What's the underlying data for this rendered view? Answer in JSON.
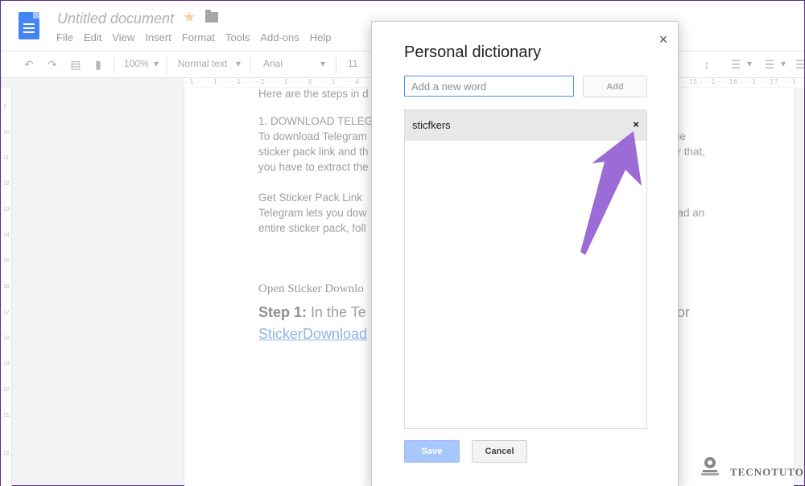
{
  "app": {
    "doc_title": "Untitled document",
    "menu": [
      "File",
      "Edit",
      "View",
      "Insert",
      "Format",
      "Tools",
      "Add-ons",
      "Help"
    ]
  },
  "toolbar": {
    "zoom": "100%",
    "style": "Normal text",
    "font": "Arial",
    "font_size": "11"
  },
  "ruler": {
    "text": "· 1 · · · 1 · · · 1 · · · 2 · · · 1 · · · 3 · · · 1 · · · 4",
    "right_text": "· 15 · · 1 · · 16 · · 1 · · 17 · · 1 · · 18 · ·",
    "vertical": [
      "1",
      "10",
      "11",
      "12",
      "13",
      "14",
      "15",
      "16",
      "17",
      "18",
      "19",
      "20",
      "21",
      "22"
    ]
  },
  "document": {
    "line1": "Here are the steps in d",
    "line2": "1. DOWNLOAD TELEG",
    "line3": "To download Telegram",
    "line3_right": "he",
    "line4": "sticker pack link and th",
    "line4_right": "er that,",
    "line5": "you have to extract the",
    "line6": "Get Sticker Pack Link",
    "line7": "Telegram lets you dow",
    "line7_right": "oad an",
    "line8": "entire sticker pack, foll",
    "line9": "Open Sticker Downlo",
    "step_label": "Step 1:",
    "step_text": " In the Te",
    "step_right": "or",
    "link_text": "StickerDownload"
  },
  "dialog": {
    "title": "Personal dictionary",
    "input_placeholder": "Add a new word",
    "add_label": "Add",
    "words": [
      "sticfkers"
    ],
    "remove_glyph": "×",
    "close_glyph": "×",
    "save_label": "Save",
    "cancel_label": "Cancel"
  },
  "watermark": {
    "text": "TECNOTUTO"
  },
  "colors": {
    "accent_blue": "#4d90fe",
    "save_blue": "#a8c7fa",
    "arrow_purple": "#9b6bd6"
  },
  "icons": [
    "docs-icon",
    "star-icon",
    "folder-icon",
    "undo-icon",
    "redo-icon",
    "print-icon",
    "paint-format-icon",
    "close-icon",
    "remove-icon",
    "arrow-annotation"
  ]
}
